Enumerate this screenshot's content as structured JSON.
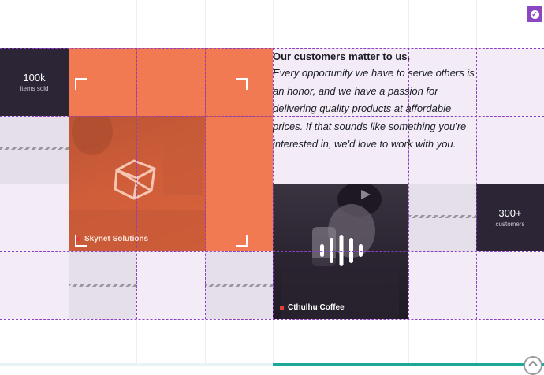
{
  "stats": [
    {
      "value": "100k",
      "label": "items sold"
    },
    {
      "value": "300+",
      "label": "customers"
    }
  ],
  "quote": {
    "heading": "Our customers matter to us.",
    "body": "Every opportunity we have to serve others is an honor, and we have a passion for delivering quality products at affordable prices. If that sounds like something you're interested in, we'd love to work with you."
  },
  "portfolio": [
    {
      "name": "Skynet Solutions",
      "icon": "cube-icon",
      "accent": "#f06a3b"
    },
    {
      "name": "Cthulhu Coffee",
      "icon": "audio-wave-icon",
      "accent": "#e2403f"
    }
  ],
  "badge": {
    "icon": "check-circle-icon",
    "color": "#8a47c1"
  },
  "scroll_top": {
    "icon": "chevron-up-icon"
  },
  "colors": {
    "grid_line": "#8b3fc2",
    "dark_tile": "#2c2535",
    "orange": "#f06a3b",
    "teal": "#1aa999"
  }
}
